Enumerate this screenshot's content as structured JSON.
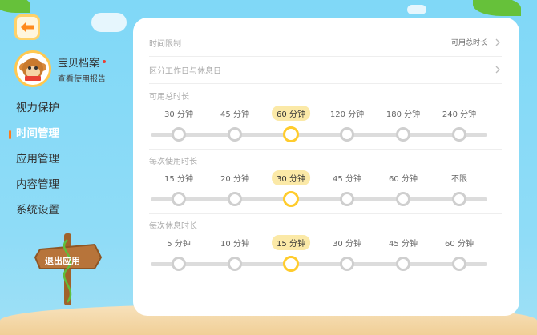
{
  "profile": {
    "name": "宝贝档案",
    "subtitle": "查看使用报告"
  },
  "nav": [
    {
      "label": "视力保护"
    },
    {
      "label": "时间管理"
    },
    {
      "label": "应用管理"
    },
    {
      "label": "内容管理"
    },
    {
      "label": "系统设置"
    }
  ],
  "nav_active_index": 1,
  "exit_label": "退出应用",
  "rows": [
    {
      "label": "时间限制",
      "value": "可用总时长"
    },
    {
      "label": "区分工作日与休息日",
      "value": ""
    }
  ],
  "sections": [
    {
      "title": "可用总时长",
      "options": [
        "30 分钟",
        "45 分钟",
        "60 分钟",
        "120 分钟",
        "180 分钟",
        "240 分钟"
      ],
      "selected_index": 2
    },
    {
      "title": "每次使用时长",
      "options": [
        "15 分钟",
        "20 分钟",
        "30 分钟",
        "45 分钟",
        "60 分钟",
        "不限"
      ],
      "selected_index": 2
    },
    {
      "title": "每次休息时长",
      "options": [
        "5 分钟",
        "10 分钟",
        "15 分钟",
        "30 分钟",
        "45 分钟",
        "60 分钟"
      ],
      "selected_index": 2
    }
  ],
  "colors": {
    "accent": "#ffcc2d",
    "selected_bg": "#fbe9a7",
    "active_marker": "#ff7a1a"
  }
}
